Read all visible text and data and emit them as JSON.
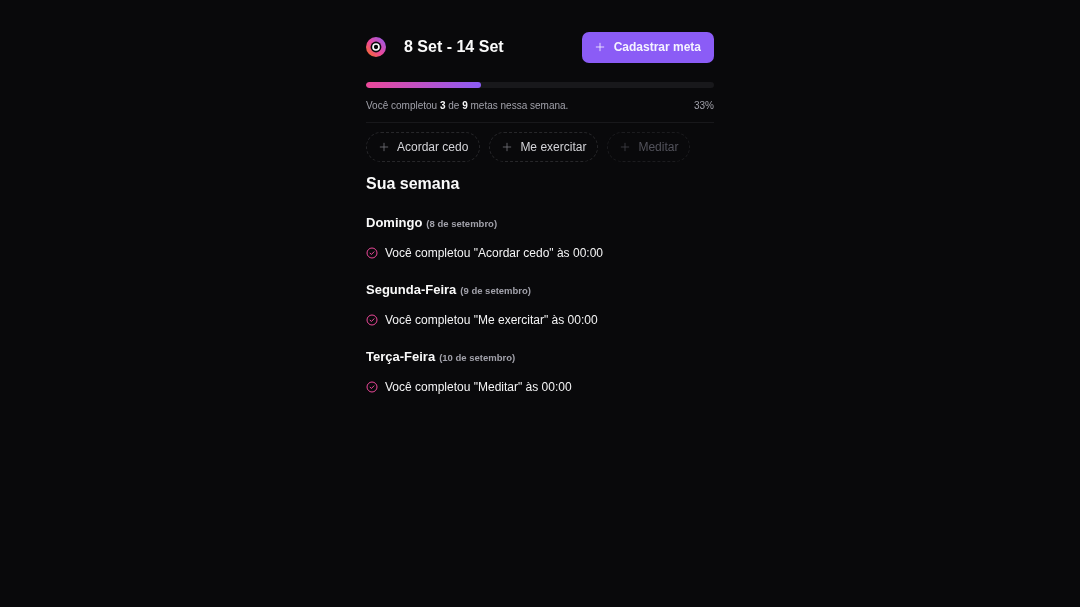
{
  "header": {
    "title": "8 Set - 14 Set",
    "button": {
      "label": "Cadastrar meta"
    }
  },
  "progress": {
    "level": 0.33,
    "summary": "Você completou **3** de **9** metas nessa semana.",
    "percent": "33%"
  },
  "goals": [
    {
      "label": "Acordar cedo",
      "disabled": false
    },
    {
      "label": "Me exercitar",
      "disabled": false
    },
    {
      "label": "Meditar",
      "disabled": true
    }
  ],
  "week": {
    "title": "Sua semana",
    "days": [
      {
        "day": "Domingo",
        "date": "(8 de setembro)",
        "entries": [
          "Você completou \"Acordar cedo\" às 00:00"
        ]
      },
      {
        "day": "Segunda-Feira",
        "date": "(9 de setembro)",
        "entries": [
          "Você completou \"Me exercitar\" às 00:00"
        ]
      },
      {
        "day": "Terça-Feira",
        "date": "(10 de setembro)",
        "entries": [
          "Você completou \"Meditar\" às 00:00"
        ]
      }
    ]
  }
}
